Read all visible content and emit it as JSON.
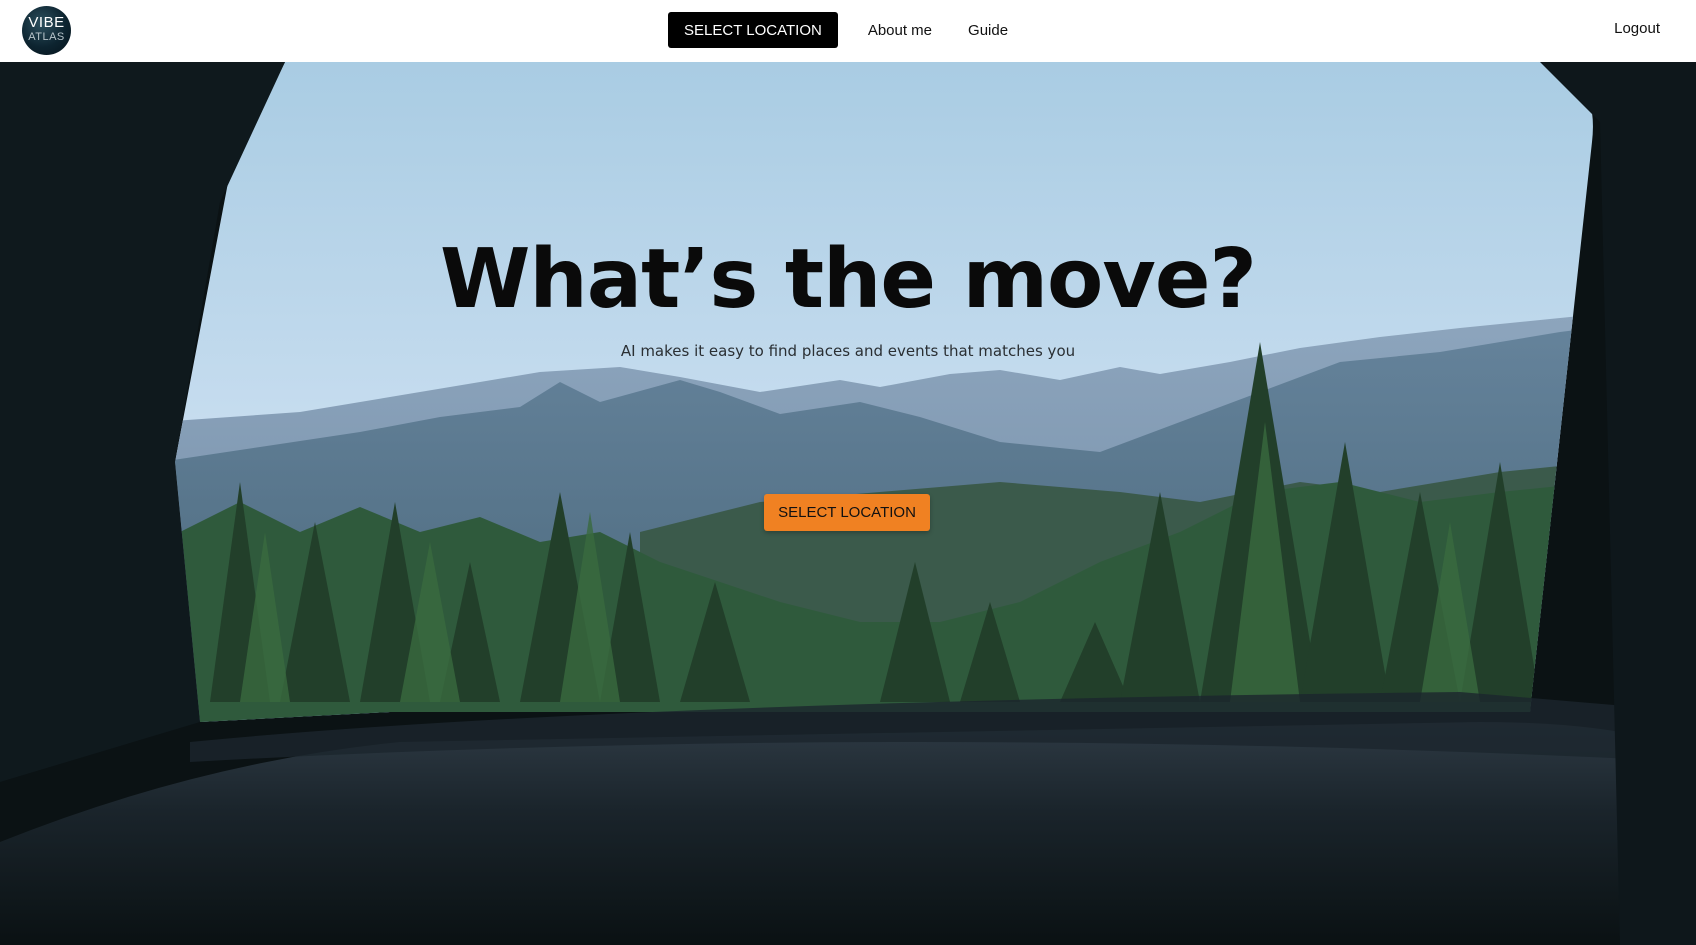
{
  "navbar": {
    "logo": {
      "line1": "VIBE",
      "line2": "ATLAS",
      "icon": "vibe-atlas-logo"
    },
    "primary_button_label": "SELECT LOCATION",
    "links": [
      "About me",
      "Guide"
    ],
    "logout_label": "Logout"
  },
  "hero": {
    "headline": "What’s the move?",
    "subline": "AI makes it easy to find places and events that matches you",
    "cta_label": "SELECT LOCATION",
    "background_image": "view of mountains and pine forest through car window"
  },
  "colors": {
    "nav_background": "#ffffff",
    "nav_button": "#000000",
    "cta": "#f08122",
    "headline": "#0a0a0a"
  }
}
